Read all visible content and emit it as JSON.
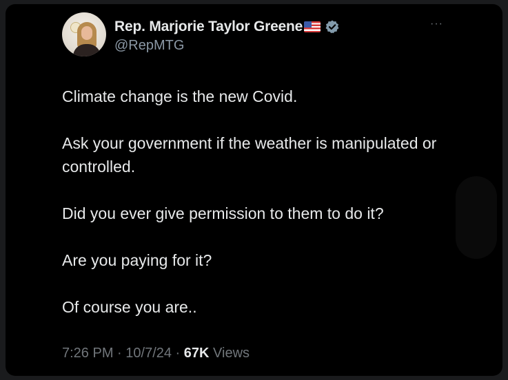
{
  "tweet": {
    "display_name": "Rep. Marjorie Taylor Greene",
    "flag_icon": "us-flag-icon",
    "verified_icon": "verified-badge-icon",
    "handle": "@RepMTG",
    "more_label": "···",
    "paragraphs": [
      {
        "text": "Climate change is the new Covid."
      },
      {
        "text": "Ask your government if the weather is manipulated or controlled."
      },
      {
        "text": "Did you ever give permission to them to do it?"
      },
      {
        "text": "Are you paying for it?"
      },
      {
        "text": "Of course you are.."
      }
    ],
    "meta": {
      "time": "7:26 PM",
      "separator": " · ",
      "date": "10/7/24",
      "views_count": "67K",
      "views_label": "Views"
    }
  },
  "colors": {
    "background": "#000000",
    "text_primary": "#e7e9ea",
    "text_secondary": "#71767b",
    "verified_badge": "#829aab"
  }
}
